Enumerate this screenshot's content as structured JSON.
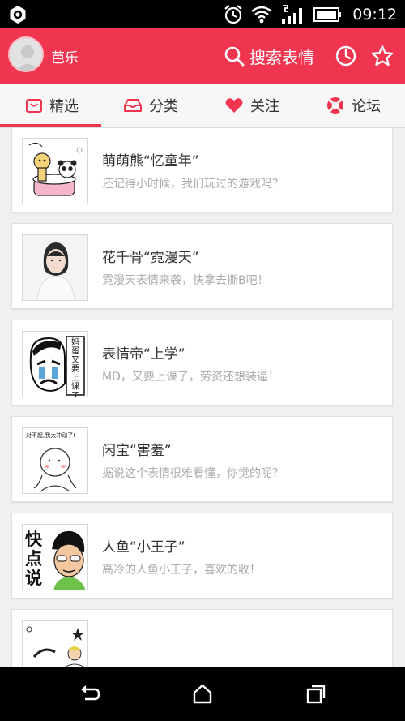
{
  "status_bar": {
    "time": "09:12",
    "icons": [
      "settings-icon",
      "alarm-icon",
      "wifi-icon",
      "signal-icon",
      "battery-icon"
    ]
  },
  "header": {
    "user_name": "芭乐",
    "search_label": "搜索表情",
    "accent_color": "#ef3550"
  },
  "tabs": [
    {
      "label": "精选",
      "icon": "bag-icon",
      "active": true
    },
    {
      "label": "分类",
      "icon": "tray-icon",
      "active": false
    },
    {
      "label": "关注",
      "icon": "heart-icon",
      "active": false
    },
    {
      "label": "论坛",
      "icon": "lifebuoy-icon",
      "active": false
    }
  ],
  "items": [
    {
      "title": "萌萌熊“忆童年”",
      "desc": "还记得小时候，我们玩过的游戏吗？"
    },
    {
      "title": "花千骨“霓漫天”",
      "desc": "霓漫天表情来袭，快拿去撕B吧！"
    },
    {
      "title": "表情帝“上学”",
      "desc": "MD，又要上课了，劳资还想装逼！"
    },
    {
      "title": "闲宝“害羞”",
      "desc": "据说这个表情很难看懂，你觉的呢？"
    },
    {
      "title": "人鱼“小王子”",
      "desc": "高冷的人鱼小王子，喜欢的收！"
    },
    {
      "title": "",
      "desc": ""
    }
  ],
  "thumb_text": {
    "item3_sign": "妈蛋又要上课了",
    "item4_caption": "对不起,我太冲动了!",
    "item5_caption": "快点说"
  },
  "nav_bar": {
    "icons": [
      "back-icon",
      "home-icon",
      "recents-icon"
    ]
  }
}
